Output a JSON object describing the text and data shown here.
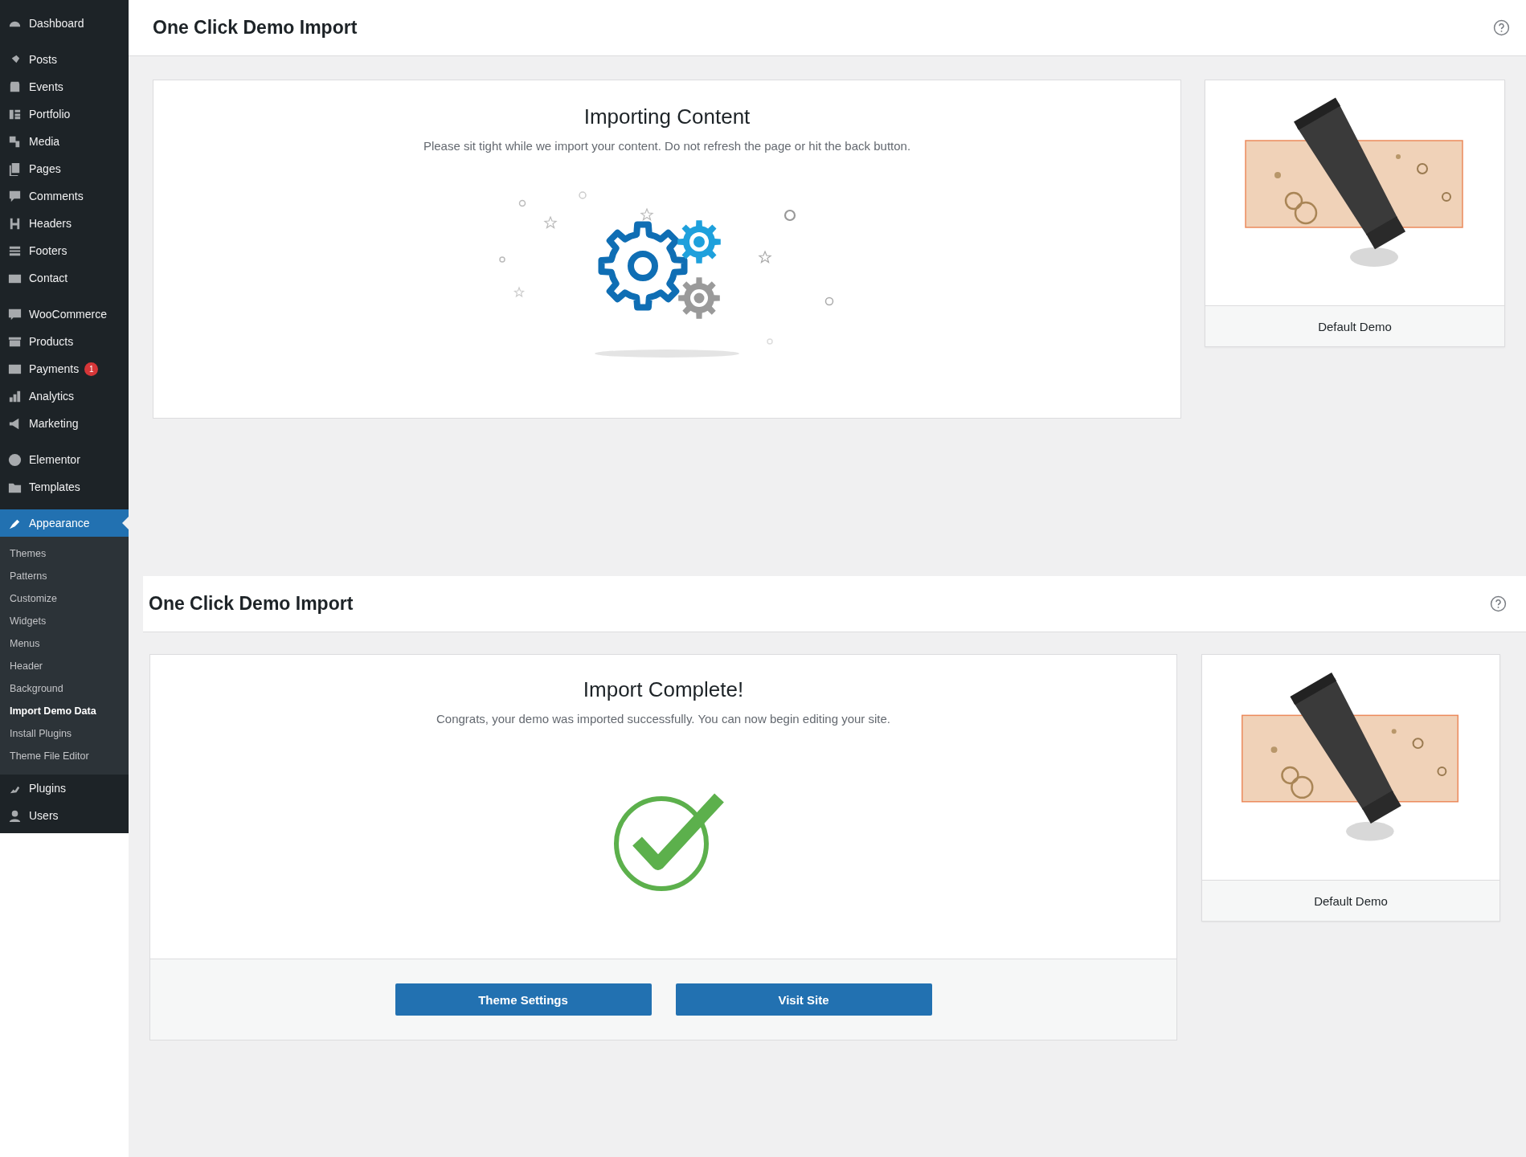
{
  "sidebar": {
    "groups": [
      [
        {
          "label": "Dashboard",
          "selected": false
        }
      ],
      [
        {
          "label": "Posts",
          "selected": false
        },
        {
          "label": "Events",
          "selected": false
        },
        {
          "label": "Portfolio",
          "selected": false
        },
        {
          "label": "Media",
          "selected": false
        },
        {
          "label": "Pages",
          "selected": false
        },
        {
          "label": "Comments",
          "selected": false
        },
        {
          "label": "Headers",
          "selected": false
        },
        {
          "label": "Footers",
          "selected": false
        },
        {
          "label": "Contact",
          "selected": false
        }
      ],
      [
        {
          "label": "WooCommerce",
          "selected": false
        },
        {
          "label": "Products",
          "selected": false
        },
        {
          "label": "Payments",
          "selected": false,
          "badge": "1"
        },
        {
          "label": "Analytics",
          "selected": false
        },
        {
          "label": "Marketing",
          "selected": false
        }
      ],
      [
        {
          "label": "Elementor",
          "selected": false
        },
        {
          "label": "Templates",
          "selected": false
        }
      ],
      [
        {
          "label": "Appearance",
          "selected": true,
          "children": [
            {
              "label": "Themes",
              "selected": false
            },
            {
              "label": "Patterns",
              "selected": false
            },
            {
              "label": "Customize",
              "selected": false
            },
            {
              "label": "Widgets",
              "selected": false
            },
            {
              "label": "Menus",
              "selected": false
            },
            {
              "label": "Header",
              "selected": false
            },
            {
              "label": "Background",
              "selected": false
            },
            {
              "label": "Import Demo Data",
              "selected": true
            },
            {
              "label": "Install Plugins",
              "selected": false
            },
            {
              "label": "Theme File Editor",
              "selected": false
            }
          ]
        },
        {
          "label": "Plugins",
          "selected": false
        },
        {
          "label": "Users",
          "selected": false
        }
      ]
    ]
  },
  "sections": [
    {
      "kind": "progress",
      "page_title": "One Click Demo Import",
      "title": "Importing Content",
      "text": "Please sit tight while we import your content. Do not refresh the page or hit the back button.",
      "demo": {
        "label": "Default Demo"
      }
    },
    {
      "kind": "complete",
      "page_title": "One Click Demo Import",
      "title": "Import Complete!",
      "text": "Congrats, your demo was imported successfully. You can now begin editing your site.",
      "demo": {
        "label": "Default Demo"
      },
      "buttons": [
        "Theme Settings",
        "Visit Site"
      ]
    }
  ]
}
